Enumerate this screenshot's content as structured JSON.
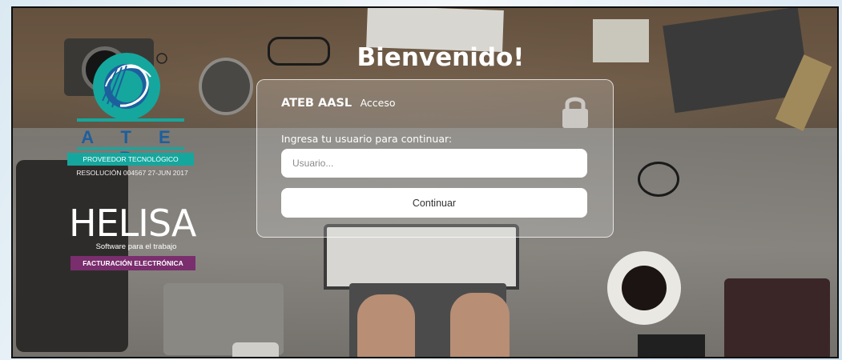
{
  "page": {
    "title": "Bienvenido!"
  },
  "branding": {
    "ateb": {
      "name": "A T E B",
      "registered_mark": "®",
      "provider_text": "PROVEEDOR TECNOLÓGICO",
      "resolution_text": "RESOLUCIÓN 004567 27-JUN 2017",
      "colors": {
        "green": "#15a79e",
        "blue": "#1d5f9d"
      }
    },
    "helisa": {
      "name": "HELISA",
      "tagline": "Software para el trabajo",
      "product": "FACTURACIÓN ELECTRÓNICA",
      "colors": {
        "purple": "#7a2e6e"
      }
    }
  },
  "login": {
    "brand": "ATEB AASL",
    "section": "Acceso",
    "lock_icon": "lock-icon",
    "prompt": "Ingresa tu usuario para continuar:",
    "username": {
      "placeholder": "Usuario...",
      "value": ""
    },
    "continue_label": "Continuar"
  }
}
